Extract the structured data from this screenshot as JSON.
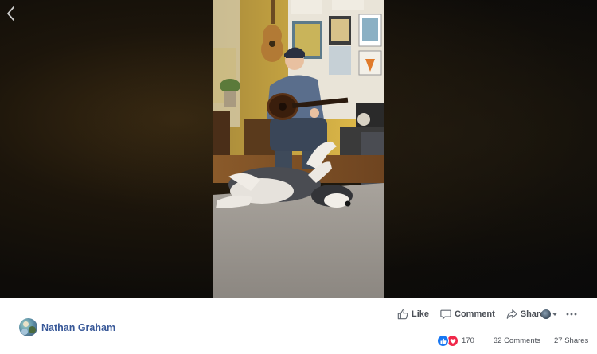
{
  "post": {
    "author_name": "Nathan Graham"
  },
  "actions": {
    "like_label": "Like",
    "comment_label": "Comment",
    "share_label": "Share"
  },
  "stats": {
    "reactions_count": "170",
    "comments_label": "32 Comments",
    "shares_label": "27 Shares"
  },
  "icons": {
    "back": "chevron-left-icon",
    "like": "thumbs-up-icon",
    "comment": "speech-bubble-icon",
    "share": "share-arrow-icon",
    "more": "more-dots-icon",
    "dropdown": "caret-down-icon",
    "reaction_like": "like-reaction-icon",
    "reaction_love": "love-reaction-icon"
  },
  "colors": {
    "brand_link": "#385898",
    "action_text": "#4b4f56",
    "like_blue": "#1877f2",
    "love_red": "#f0284a"
  }
}
